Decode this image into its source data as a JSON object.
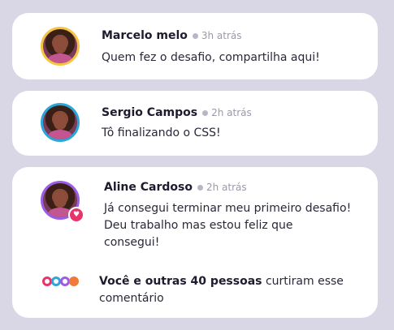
{
  "comments": [
    {
      "name": "Marcelo melo",
      "time": "3h atrás",
      "text": "Quem fez o desafio, compartilha aqui!",
      "ring": "#f4c542"
    },
    {
      "name": "Sergio Campos",
      "time": "2h atrás",
      "text": "Tô finalizando o CSS!",
      "ring": "#2aa7d8"
    },
    {
      "name": "Aline Cardoso",
      "time": "2h atrás",
      "text": "Já consegui terminar meu primeiro desafio! Deu trabalho mas estou feliz que consegui!",
      "ring": "#9b5de5"
    }
  ],
  "likes": {
    "bold": "Você e outras 40 pessoas",
    "rest": " curtiram esse comentário",
    "icon_colors": [
      "#e8336b",
      "#2aa7d8",
      "#9b5de5",
      "#f07a3a"
    ]
  },
  "colors": {
    "background": "#d9d6e6",
    "card": "#ffffff",
    "heart": "#e8336b"
  }
}
